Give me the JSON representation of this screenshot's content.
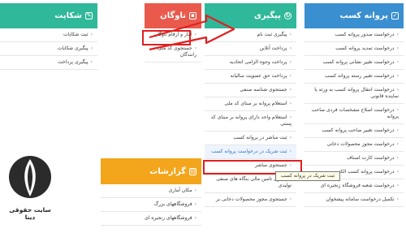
{
  "columns": {
    "blue": {
      "title": "پروانه کسب",
      "items": [
        "درخواست صدور پروانه کسب",
        "درخواست تمدید پروانه کسب",
        "درخواست تغییر نشانی پروانه کسب",
        "درخواست تغییر رسته پروانه کسب",
        "درخواست انتقال پروانه کسب به ورثه یا نماینده قانونی",
        "درخواست اصلاح مشخصات فردی صاحب پروانه",
        "درخواست تغییر صاحب پروانه کسب",
        "درخواست مجوز محصولات دخانی",
        "درخواست کارت اصناف",
        "درخواست پروانه کسب الکتی",
        "درخواست شعبه فروشگاه زنجیره ای",
        "تکمیل درخواست سامانه پیشخوان"
      ]
    },
    "green": {
      "title": "پیگیری",
      "items": [
        "پیگیری ثبت نام",
        "پرداخت آنلاین",
        "پرداخت وجوه الزامی اتحادیه",
        "پرداخت حق عضویت سالیانه",
        "جستجوی شناسه صنفی",
        "استعلام پروانه بر مبنای کد ملی",
        "استعلام واحد دارای پروانه بر مبنای کد پستی",
        "ثبت مباشر در پروانه کسب",
        "ثبت شریک در درخواست پروانه کسب",
        "جستجوی مباشر",
        "پیگیری تامین مالی بنگاه های صنفی تولیدی",
        "جستجوی مجوز محصولات دخانی بر"
      ]
    },
    "red": {
      "title": "ناوگان",
      "items": [
        "آمار و ارقام ناوگان",
        "جستجوی کد ملی رانندگان"
      ]
    },
    "left": {
      "title": "شکایت",
      "items": [
        "ثبت شکایات",
        "پیگیری شکایات",
        "پیگیری پرداخت"
      ]
    },
    "orange": {
      "title": "گزارشات",
      "items": [
        "مکان آماری",
        "فروشگاههای بزرگ",
        "فروشگاههای زنجیره ای"
      ]
    }
  },
  "tooltip": "ثبت شریک در پروانه کسب",
  "watermark": "سایت حقوقی دینا",
  "colors": {
    "blue": "#3a8fd1",
    "green": "#2fb89a",
    "red": "#ea5a4c",
    "orange": "#f3a51c",
    "annotation": "#e02020"
  }
}
